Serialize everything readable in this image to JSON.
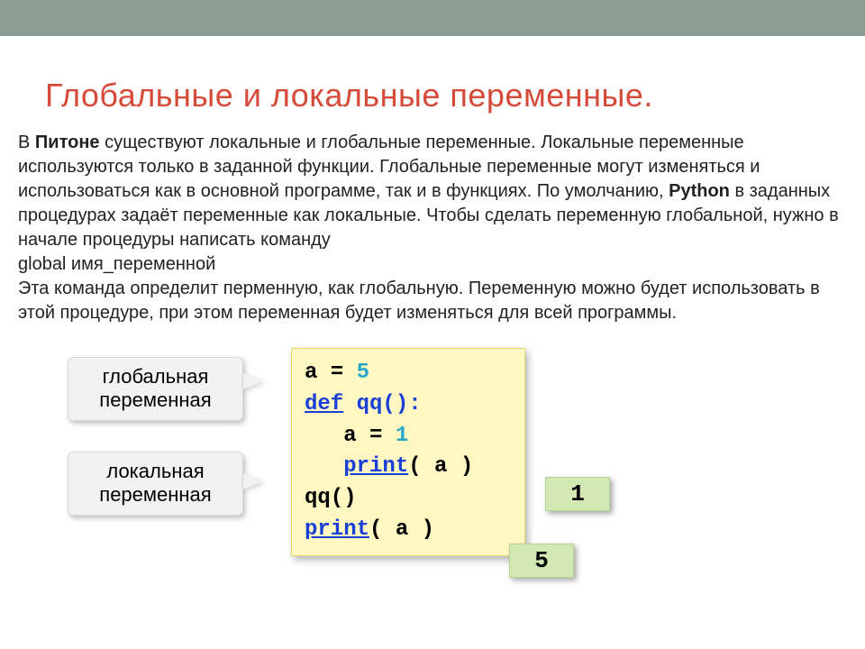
{
  "title": "Глобальные и локальные переменные.",
  "paragraph": {
    "p1a": "В ",
    "p1b": "Питоне",
    "p1c": " существуют локальные и глобальные переменные. Локальные переменные используются только в заданной функции. Глобальные переменные могут изменяться и использоваться как  в основной программе, так и в функциях. По умолчанию, ",
    "p1d": "Python",
    "p1e": " в заданных процедурах задаёт переменные как локальные. Чтобы сделать переменную глобальной, нужно в начале процедуры написать команду",
    "p2": "global имя_переменной",
    "p3": "Эта команда определит перменную, как глобальную. Переменную можно будет использовать в этой процедуре, при этом переменная будет изменяться для всей программы."
  },
  "labels": {
    "global_line1": "глобальная",
    "global_line2": "переменная",
    "local_line1": "локальная",
    "local_line2": "переменная"
  },
  "code": {
    "l1a": "a",
    "l1b": " = ",
    "l1c": "5",
    "l2a": "def",
    "l2b": " qq():",
    "l3a": "   a",
    "l3b": " = ",
    "l3c": "1",
    "l4a": "   ",
    "l4b": "print",
    "l4c": "( a )",
    "l5a": "qq()",
    "l6a": "print",
    "l6b": "( a )"
  },
  "outputs": {
    "o1": "1",
    "o2": "5"
  }
}
